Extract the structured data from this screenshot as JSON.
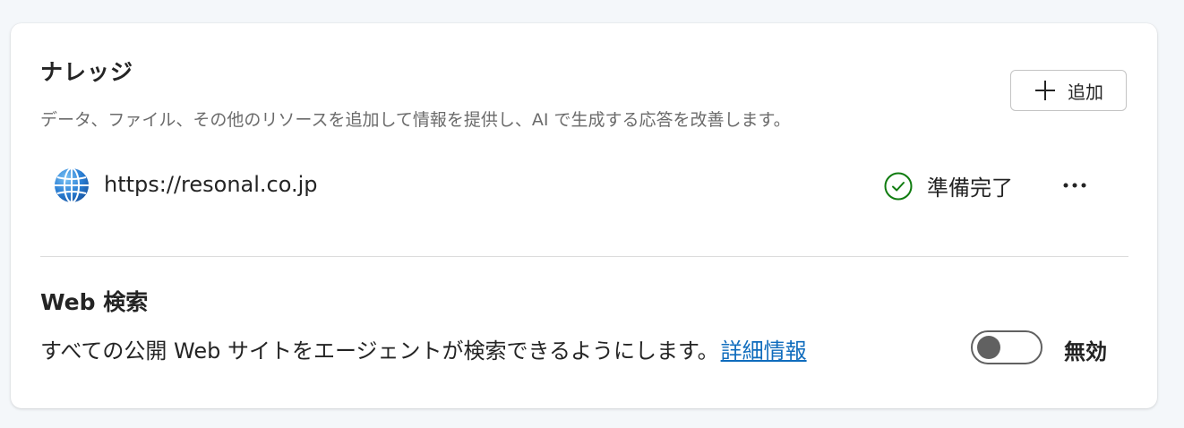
{
  "knowledge": {
    "title": "ナレッジ",
    "description": "データ、ファイル、その他のリソースを追加して情報を提供し、AI で生成する応答を改善します。",
    "add_button_label": "追加",
    "items": [
      {
        "url": "https://resonal.co.jp",
        "icon": "globe-icon",
        "status": "準備完了",
        "status_icon": "check-circle-icon",
        "status_color": "#107c10"
      }
    ]
  },
  "web_search": {
    "title": "Web 検索",
    "description": "すべての公開 Web サイトをエージェントが検索できるようにします。",
    "link_label": "詳細情報",
    "toggle_state": "off",
    "toggle_label": "無効"
  },
  "colors": {
    "link": "#0f6cbd",
    "ready": "#107c10",
    "toggle_off": "#616161"
  }
}
